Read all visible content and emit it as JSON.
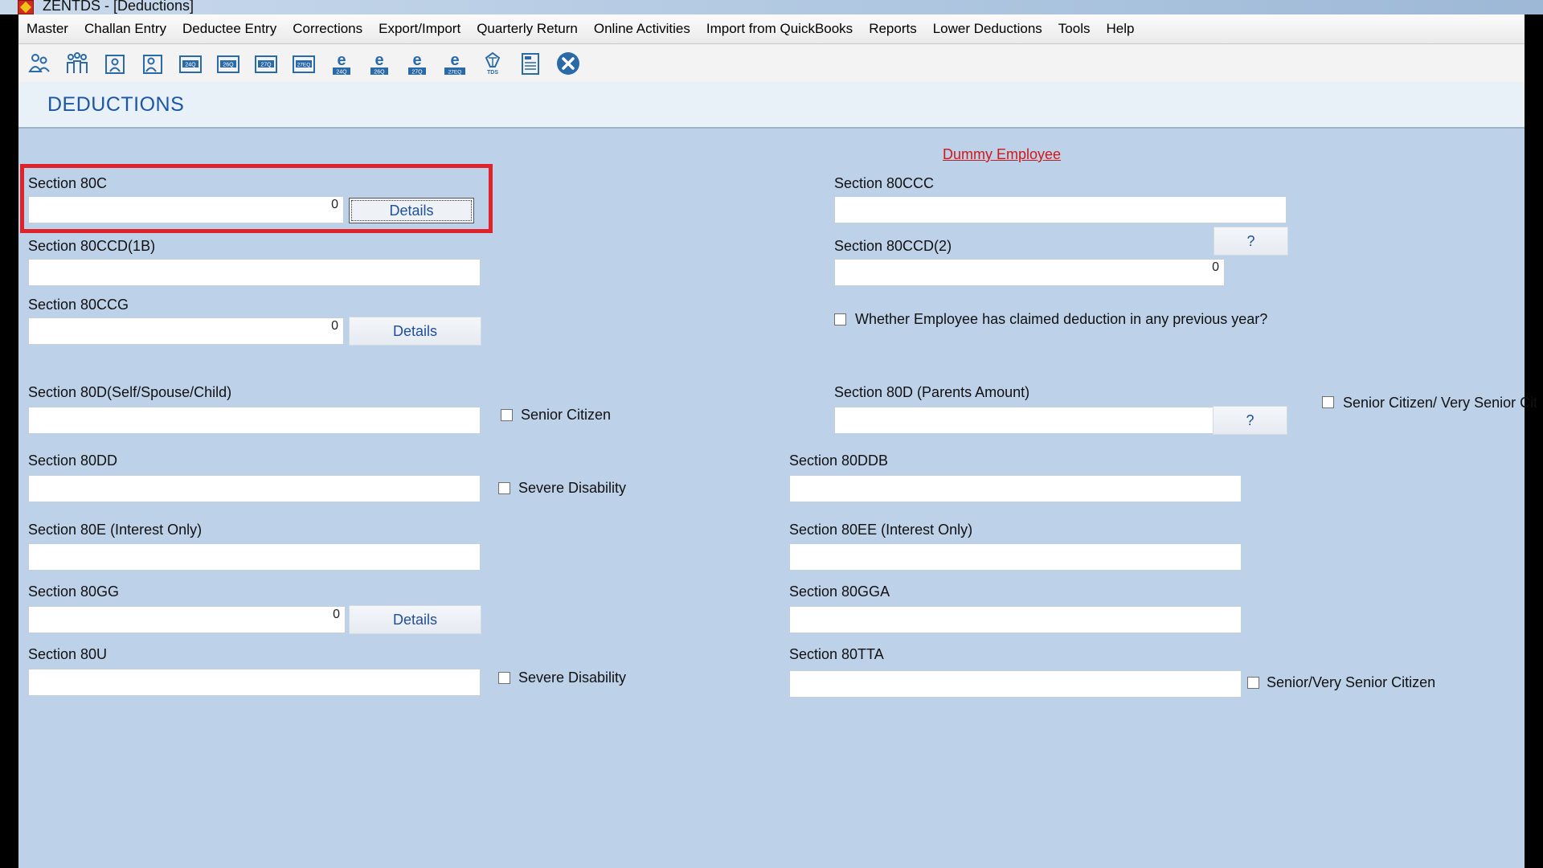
{
  "window": {
    "title": "ZENTDS - [Deductions]"
  },
  "menu": [
    "Master",
    "Challan Entry",
    "Deductee Entry",
    "Corrections",
    "Export/Import",
    "Quarterly Return",
    "Online Activities",
    "Import from QuickBooks",
    "Reports",
    "Lower Deductions",
    "Tools",
    "Help"
  ],
  "toolbar": {
    "icons": [
      "deductor-icon",
      "employees-icon",
      "add-employee-icon",
      "employee-icon",
      "form-24q-icon",
      "form-26q-icon",
      "form-27q-icon",
      "form-27eq-icon",
      "e-return-24q-icon",
      "e-return-26q-icon",
      "e-return-27q-icon",
      "e-return-27eq-icon",
      "tds-icon",
      "report-icon",
      "close-icon"
    ],
    "labels": {
      "form24q": "24Q",
      "form26q": "26Q",
      "form27q": "27Q",
      "form27eq": "27EQ",
      "e24q": "24Q",
      "e26q": "26Q",
      "e27q": "27Q",
      "e27eq": "27EQ",
      "tds": "TDS"
    }
  },
  "page": {
    "title": "DEDUCTIONS"
  },
  "employee_link": "Dummy Employee",
  "fields": {
    "s80c": {
      "label": "Section 80C",
      "value": "0",
      "details": "Details"
    },
    "s80ccd1b": {
      "label": "Section 80CCD(1B)",
      "value": ""
    },
    "s80ccg": {
      "label": "Section 80CCG",
      "value": "0",
      "details": "Details"
    },
    "s80d_self": {
      "label": "Section 80D(Self/Spouse/Child)",
      "value": "",
      "checkbox": "Senior Citizen"
    },
    "s80dd": {
      "label": "Section 80DD",
      "value": "",
      "checkbox": "Severe Disability"
    },
    "s80e": {
      "label": "Section 80E   (Interest Only)",
      "value": ""
    },
    "s80gg": {
      "label": "Section 80GG",
      "value": "0",
      "details": "Details"
    },
    "s80u": {
      "label": "Section 80U",
      "value": "",
      "checkbox": "Severe Disability"
    },
    "s80ccc": {
      "label": "Section 80CCC",
      "value": ""
    },
    "s80ccd2": {
      "label": "Section 80CCD(2)",
      "value": "0",
      "help": "?"
    },
    "prev_year_claim": {
      "checkbox": "Whether Employee has claimed deduction in any previous year?"
    },
    "s80d_parents": {
      "label": "Section 80D (Parents Amount)",
      "value": "",
      "help": "?",
      "checkbox": "Senior Citizen/ Very Senior Citizen"
    },
    "s80ddb": {
      "label": "Section 80DDB",
      "value": ""
    },
    "s80ee": {
      "label": "Section 80EE (Interest Only)",
      "value": ""
    },
    "s80gga": {
      "label": "Section 80GGA",
      "value": ""
    },
    "s80tta": {
      "label": "Section 80TTA",
      "value": "",
      "checkbox": "Senior/Very Senior Citizen"
    }
  },
  "colors": {
    "form_bg": "#bdd1e9",
    "title_blue": "#1d56a8",
    "highlight_red": "#e0232b",
    "link_red": "#d01818"
  }
}
